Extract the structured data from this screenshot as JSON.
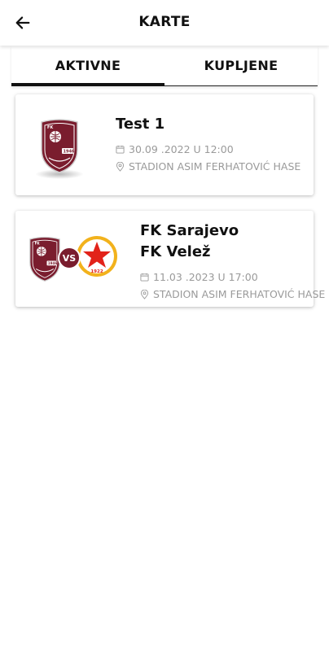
{
  "header": {
    "title": "KARTE"
  },
  "tabs": [
    {
      "label": "AKTIVNE",
      "active": true
    },
    {
      "label": "KUPLJENE",
      "active": false
    }
  ],
  "tickets": [
    {
      "title": "Test 1",
      "date": "30.09 .2022 U 12:00",
      "venue": "STADION ASIM FERHATOVIĆ HASE",
      "logo_text": "FK Sarajevo",
      "logo_year": "1946"
    },
    {
      "title_line1": "FK Sarajevo",
      "title_line2": "FK Velež",
      "date": "11.03 .2023 U 17:00",
      "venue": "STADION ASIM FERHATOVIĆ HASE",
      "vs": "VS",
      "home_logo_year": "1946",
      "away_logo_year": "1922"
    }
  ],
  "icons": {
    "back": "arrow-left-icon",
    "date": "calendar-icon",
    "venue": "location-pin-icon"
  },
  "colors": {
    "sarajevo_maroon": "#7a1d2e",
    "velez_red": "#e2231a",
    "velez_gold": "#f2b21c"
  }
}
